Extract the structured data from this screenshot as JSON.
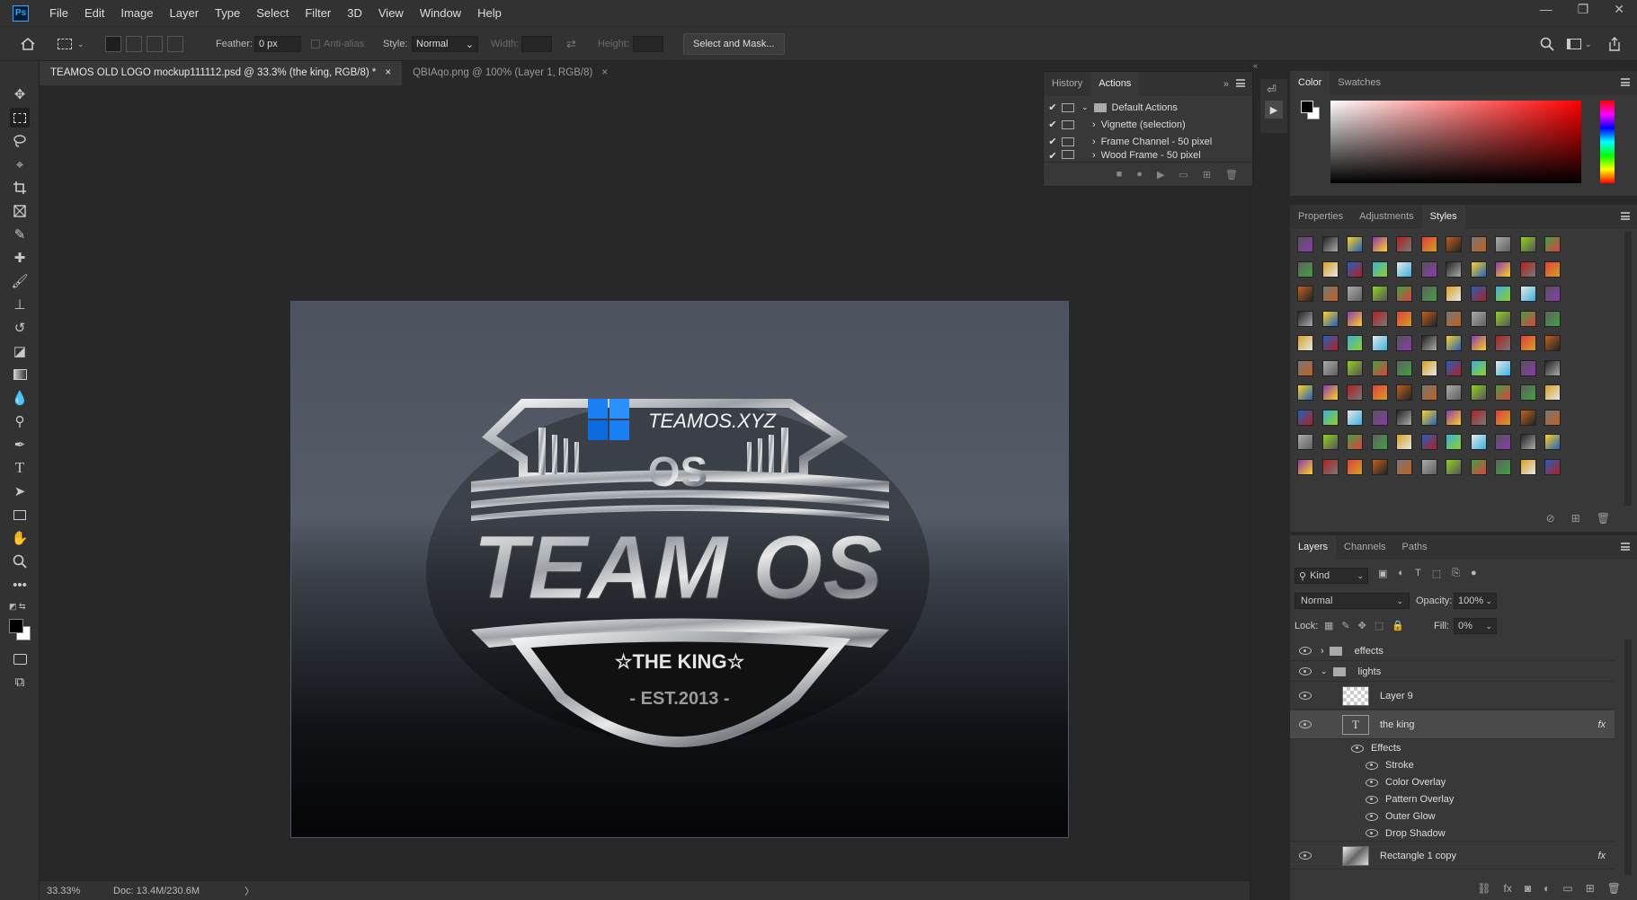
{
  "menubar": {
    "logo": "Ps",
    "items": [
      "File",
      "Edit",
      "Image",
      "Layer",
      "Type",
      "Select",
      "Filter",
      "3D",
      "View",
      "Window",
      "Help"
    ],
    "win_controls": [
      "—",
      "❐",
      "✕"
    ]
  },
  "options": {
    "feather_label": "Feather:",
    "feather_value": "0 px",
    "antialias": "Anti-alias",
    "style_label": "Style:",
    "style_value": "Normal",
    "width_label": "Width:",
    "height_label": "Height:",
    "select_mask": "Select and Mask..."
  },
  "tabs": [
    {
      "label": "TEAMOS OLD LOGO mockup111112.psd @ 33.3% (the king, RGB/8) *",
      "close": "×"
    },
    {
      "label": "QBIAqo.png @ 100% (Layer 1, RGB/8)",
      "close": "×"
    }
  ],
  "artwork": {
    "banner": "TEAMOS.XYZ",
    "os": "OS",
    "team": "TEAM OS",
    "king": "☆THE KING☆",
    "est": "- EST.2013 -"
  },
  "status": {
    "zoom": "33.33%",
    "doc": "Doc: 13.4M/230.6M",
    "arrow": "〉"
  },
  "history": {
    "tabs": [
      "History",
      "Actions"
    ],
    "items": [
      "Default Actions",
      "Vignette (selection)",
      "Frame Channel - 50 pixel",
      "Wood Frame - 50 pixel"
    ]
  },
  "color": {
    "tabs": [
      "Color",
      "Swatches"
    ],
    "accent": "#ff0000"
  },
  "styles": {
    "tabs": [
      "Properties",
      "Adjustments",
      "Styles"
    ]
  },
  "layers": {
    "tabs": [
      "Layers",
      "Channels",
      "Paths"
    ],
    "kind": "Kind",
    "blend": "Normal",
    "opacity_label": "Opacity:",
    "opacity": "100%",
    "lock_label": "Lock:",
    "fill_label": "Fill:",
    "fill": "0%",
    "rows": [
      "effects",
      "lights",
      "Layer 9",
      "the king",
      "Effects",
      "Stroke",
      "Color Overlay",
      "Pattern Overlay",
      "Outer Glow",
      "Drop Shadow",
      "Rectangle 1 copy"
    ],
    "fx": "fx"
  }
}
